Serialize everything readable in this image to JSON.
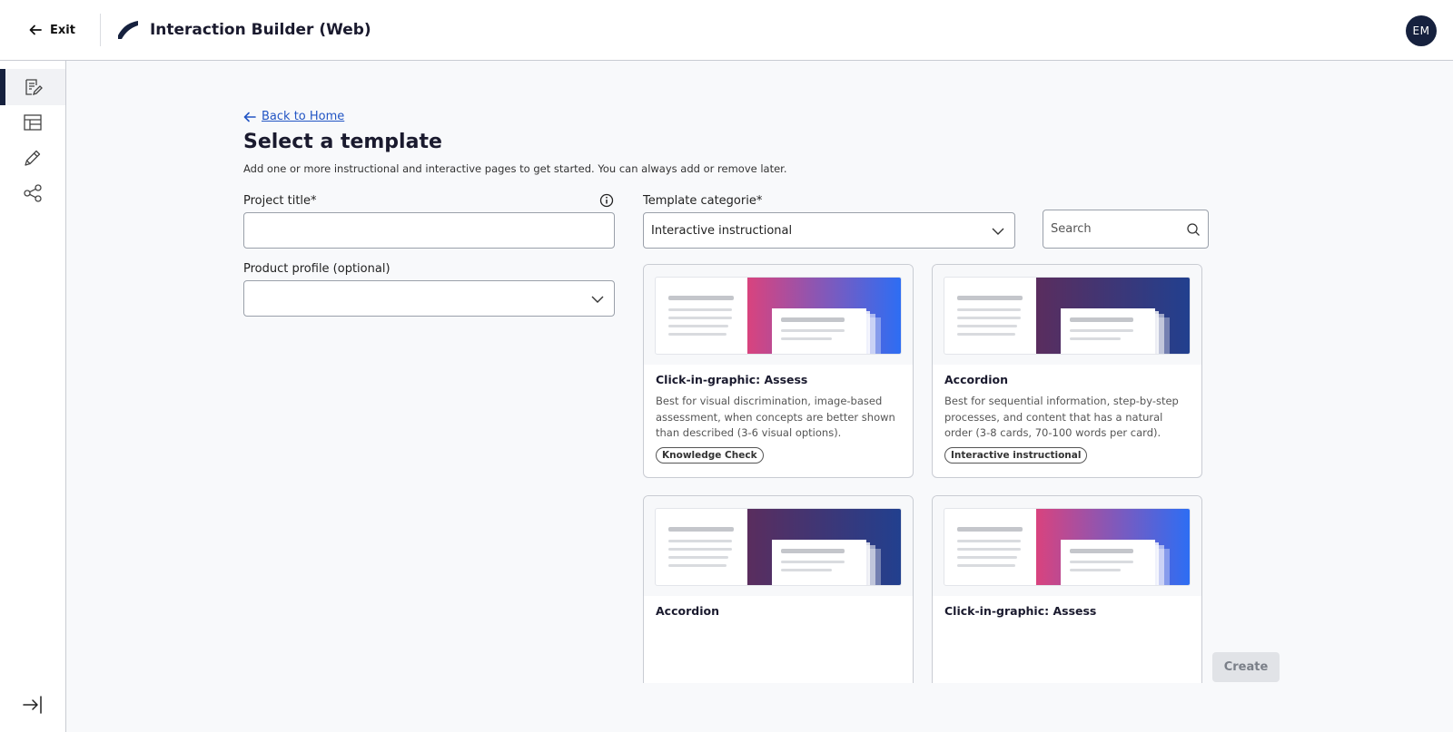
{
  "header": {
    "exit_label": "Exit",
    "app_title": "Interaction Builder (Web)",
    "avatar_initials": "EM",
    "icons": [
      "arrow-left-icon",
      "brand-logo-icon"
    ]
  },
  "rail": {
    "items": [
      "pages-edit-icon",
      "layout-icon",
      "pencil-icon",
      "share-nodes-icon"
    ],
    "active_index": 0,
    "expand_icon": "expand-rail-icon"
  },
  "page": {
    "back_link": "Back to Home",
    "title": "Select a template",
    "subtitle": "Add one or more instructional and interactive pages to get started. You can always add or remove later."
  },
  "form": {
    "project_title_label": "Project title*",
    "project_title_value": "",
    "product_profile_label": "Product profile (optional)",
    "product_profile_value": "",
    "template_category_label": "Template categorie*",
    "template_category_value": "Interactive instructional",
    "search_placeholder": "Search"
  },
  "cards": [
    {
      "title": "Click-in-graphic: Assess",
      "description": "Best for visual discrimination, image-based assessment, when concepts are better shown than described (3-6 visual options).",
      "tag": "Knowledge Check",
      "theme": "pink-blue"
    },
    {
      "title": "Accordion",
      "description": "Best for sequential information, step-by-step processes, and content that has a natural order (3-8 cards, 70-100 words per card).",
      "tag": "Interactive instructional",
      "theme": "purple-navy"
    },
    {
      "title": "Accordion",
      "description": "",
      "tag": "",
      "theme": "purple-navy"
    },
    {
      "title": "Click-in-graphic: Assess",
      "description": "",
      "tag": "",
      "theme": "pink-blue"
    }
  ],
  "footer": {
    "create_label": "Create"
  },
  "colors": {
    "accent_link": "#2255c4",
    "navy": "#16213e",
    "pink": "#d9437e",
    "blue": "#2b6ef5",
    "purple": "#5a2d5e",
    "navy_blue": "#21408f"
  }
}
